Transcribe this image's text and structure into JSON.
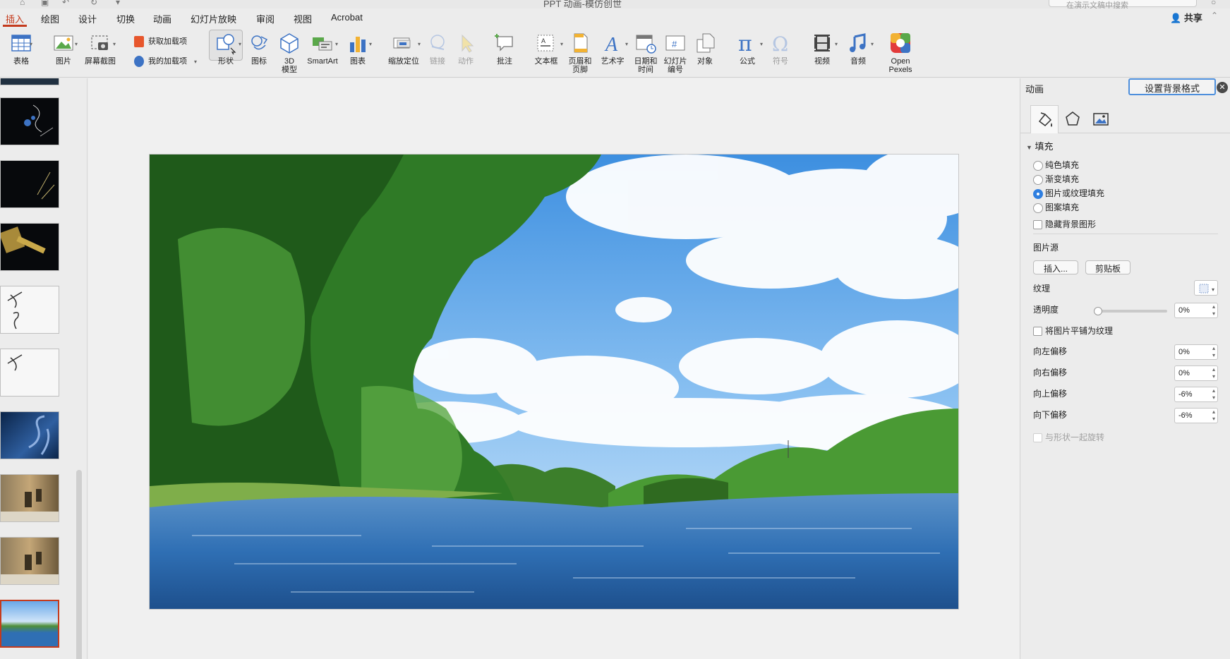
{
  "window": {
    "title": "PPT 动画-模仿创世",
    "search_placeholder": "在演示文稿中搜索"
  },
  "tabs": [
    {
      "label": "插入"
    },
    {
      "label": "绘图"
    },
    {
      "label": "设计"
    },
    {
      "label": "切换"
    },
    {
      "label": "动画"
    },
    {
      "label": "幻灯片放映"
    },
    {
      "label": "审阅"
    },
    {
      "label": "视图"
    },
    {
      "label": "Acrobat"
    }
  ],
  "share_label": "共享",
  "ribbon": {
    "table": "表格",
    "picture": "图片",
    "screenshot": "屏幕截图",
    "get_addins": "获取加载项",
    "my_addins": "我的加载项",
    "shapes": "形状",
    "icons": "图标",
    "model3d": "3D\n模型",
    "smartart": "SmartArt",
    "chart": "图表",
    "zoom": "缩放定位",
    "link": "链接",
    "action": "动作",
    "comment": "批注",
    "textbox": "文本框",
    "header_footer": "页眉和\n页脚",
    "wordart": "艺术字",
    "datetime": "日期和\n时间",
    "slide_number": "幻灯片\n编号",
    "object": "对象",
    "equation": "公式",
    "symbol": "符号",
    "video": "视频",
    "audio": "音频",
    "open_pexels": "Open\nPexels"
  },
  "pane": {
    "tab_animation": "动画",
    "tab_format": "设置背景格式",
    "section_fill": "填充",
    "fill_options": [
      {
        "label": "纯色填充",
        "selected": false
      },
      {
        "label": "渐变填充",
        "selected": false
      },
      {
        "label": "图片或纹理填充",
        "selected": true
      },
      {
        "label": "图案填充",
        "selected": false
      }
    ],
    "hide_background": "隐藏背景图形",
    "picture_source": "图片源",
    "insert_btn": "插入...",
    "clipboard_btn": "剪贴板",
    "texture": "纹理",
    "transparency": "透明度",
    "transparency_value": "0%",
    "tile_as_texture": "将图片平铺为纹理",
    "offset_left": "向左偏移",
    "offset_left_value": "0%",
    "offset_right": "向右偏移",
    "offset_right_value": "0%",
    "offset_top": "向上偏移",
    "offset_top_value": "-6%",
    "offset_bottom": "向下偏移",
    "offset_bottom_value": "-6%",
    "rotate_with_shape": "与形状一起旋转"
  },
  "colors": {
    "accent": "#c43b1d",
    "selection_blue": "#2f7fe0"
  }
}
